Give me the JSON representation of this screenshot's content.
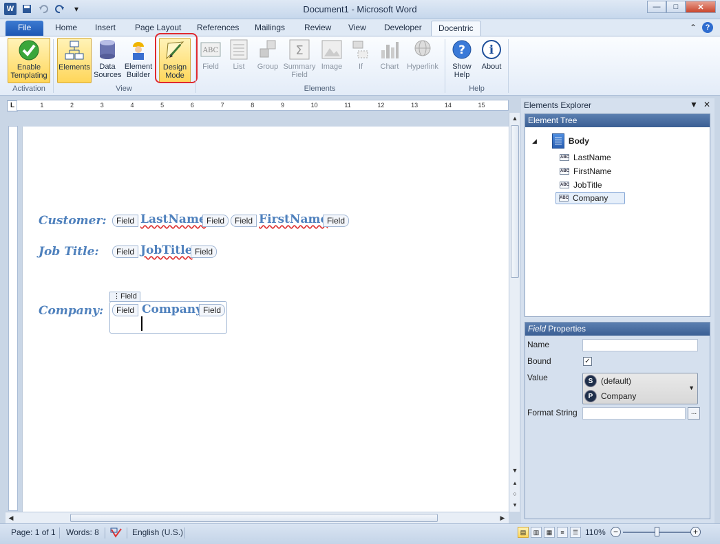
{
  "window": {
    "title": "Document1 - Microsoft Word",
    "logo": "W",
    "controls": {
      "minimize": "—",
      "maximize": "□",
      "close": "✕"
    }
  },
  "quick_access": {
    "save_icon": "save-icon",
    "undo_icon": "undo-icon",
    "redo_icon": "redo-icon"
  },
  "tabs": [
    {
      "label": "File"
    },
    {
      "label": "Home"
    },
    {
      "label": "Insert"
    },
    {
      "label": "Page Layout"
    },
    {
      "label": "References"
    },
    {
      "label": "Mailings"
    },
    {
      "label": "Review"
    },
    {
      "label": "View"
    },
    {
      "label": "Developer"
    },
    {
      "label": "Docentric"
    }
  ],
  "ribbon": {
    "enable_templating": "Enable Templating",
    "elements": "Elements",
    "data_sources": "Data Sources",
    "element_builder": "Element Builder",
    "design_mode": "Design Mode",
    "field": "Field",
    "list": "List",
    "group": "Group",
    "summary_field": "Summary Field",
    "image": "Image",
    "if": "If",
    "chart": "Chart",
    "hyperlink": "Hyperlink",
    "show_help": "Show Help",
    "about": "About",
    "groups": {
      "activation": "Activation",
      "view": "View",
      "elements": "Elements",
      "help": "Help"
    }
  },
  "ruler": {
    "numbers": [
      "1",
      "2",
      "3",
      "4",
      "5",
      "6",
      "7",
      "8",
      "9",
      "10",
      "11",
      "12",
      "13",
      "14",
      "15"
    ]
  },
  "document": {
    "customer_label": "Customer:",
    "jobtitle_label": "Job Title:",
    "company_label": "Company:",
    "field_tag": "Field",
    "lastname": "LastName",
    "firstname": "FirstName",
    "jobtitle": "JobTitle",
    "company": "Company",
    "design_tag": "⋮Field"
  },
  "panel": {
    "title": "Elements Explorer",
    "tree_head": "Element Tree",
    "root": "Body",
    "nodes": [
      "LastName",
      "FirstName",
      "JobTitle",
      "Company"
    ],
    "props_head_italic": "Field",
    "props_head_rest": "Properties",
    "props": {
      "name_label": "Name",
      "bound_label": "Bound",
      "bound_check": "✓",
      "value_label": "Value",
      "value_default": "(default)",
      "value_company": "Company",
      "format_label": "Format String",
      "ellipsis": "..."
    }
  },
  "status": {
    "page": "Page: 1 of 1",
    "words": "Words: 8",
    "language": "English (U.S.)",
    "zoom": "110%"
  }
}
